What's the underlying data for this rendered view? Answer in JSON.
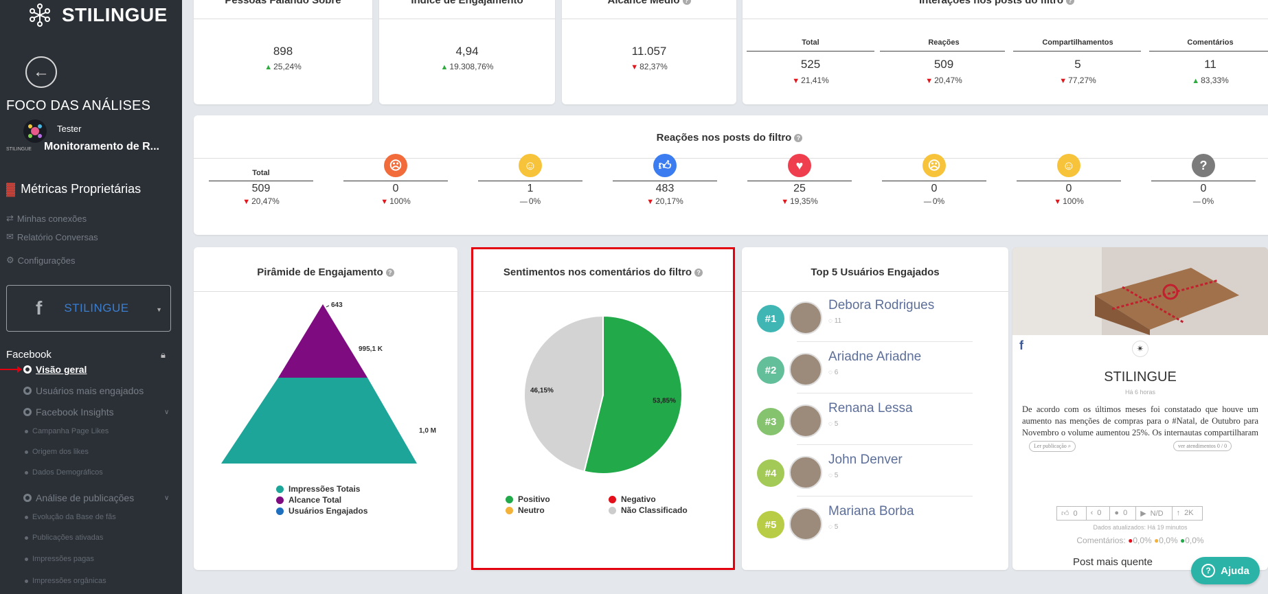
{
  "sidebar": {
    "brand": "STILINGUE",
    "focus_title": "FOCO DAS ANÁLISES",
    "account_user": "Tester",
    "account_small": "STILINGUE",
    "account_project": "Monitoramento de R...",
    "owned_metrics": "Métricas Proprietárias",
    "links": [
      "Minhas conexões",
      "Relatório Conversas",
      "Configurações"
    ],
    "page_selector": "STILINGUE",
    "section": "Facebook",
    "nav": [
      {
        "label": "Visão geral",
        "active": true
      },
      {
        "label": "Usuários mais engajados"
      },
      {
        "label": "Facebook Insights",
        "sub": [
          "Campanha Page Likes",
          "Origem dos likes",
          "Dados Demográficos"
        ]
      },
      {
        "label": "Análise de publicações",
        "sub": [
          "Evolução da Base de fãs",
          "Publicações ativadas",
          "Impressões pagas",
          "Impressões orgânicas"
        ]
      }
    ]
  },
  "top_metrics": [
    {
      "title": "Pessoas Falando Sobre",
      "value": "898",
      "change": "25,24%",
      "trend": "up"
    },
    {
      "title": "Índice de Engajamento",
      "value": "4,94",
      "change": "19.308,76%",
      "trend": "up"
    },
    {
      "title": "Alcance Médio",
      "value": "11.057",
      "change": "82,37%",
      "trend": "down"
    }
  ],
  "interactions": {
    "title": "Interações nos posts do filtro",
    "columns": [
      {
        "label": "Total",
        "value": "525",
        "change": "21,41%",
        "trend": "down"
      },
      {
        "label": "Reações",
        "value": "509",
        "change": "20,47%",
        "trend": "down"
      },
      {
        "label": "Compartilhamentos",
        "value": "5",
        "change": "77,27%",
        "trend": "down"
      },
      {
        "label": "Comentários",
        "value": "11",
        "change": "83,33%",
        "trend": "up"
      }
    ]
  },
  "reactions": {
    "title": "Reações nos posts do filtro",
    "total_label": "Total",
    "columns": [
      {
        "icon": "total",
        "value": "509",
        "change": "20,47%",
        "trend": "down"
      },
      {
        "icon": "angry-icon",
        "color": "#f26b3a",
        "value": "0",
        "change": "100%",
        "trend": "down"
      },
      {
        "icon": "haha-icon",
        "color": "#f7c33b",
        "value": "1",
        "change": "0%",
        "trend": "flat"
      },
      {
        "icon": "like-icon",
        "color": "#3b7cf0",
        "value": "483",
        "change": "20,17%",
        "trend": "down"
      },
      {
        "icon": "love-icon",
        "color": "#ef3f4f",
        "value": "25",
        "change": "19,35%",
        "trend": "down"
      },
      {
        "icon": "sad-icon",
        "color": "#f7c33b",
        "value": "0",
        "change": "0%",
        "trend": "flat"
      },
      {
        "icon": "wow-icon",
        "color": "#f7c33b",
        "value": "0",
        "change": "100%",
        "trend": "down"
      },
      {
        "icon": "question-icon",
        "color": "#7b7b7b",
        "value": "0",
        "change": "0%",
        "trend": "flat"
      }
    ]
  },
  "pyramid": {
    "title": "Pirâmide de Engajamento",
    "labels": [
      "643",
      "995,1 K",
      "1,0 M"
    ],
    "legend": [
      "Impressões Totais",
      "Alcance Total",
      "Usuários Engajados"
    ],
    "colors": {
      "impressoes": "#1ea59a",
      "alcance": "#7e0b80",
      "usuarios": "#1f6fbf"
    }
  },
  "sentiment": {
    "title": "Sentimentos nos comentários do filtro",
    "legend": [
      "Positivo",
      "Negativo",
      "Neutro",
      "Não Classificado"
    ],
    "legend_colors": [
      "#22a94a",
      "#e3101b",
      "#f3b23a",
      "#cccccc"
    ]
  },
  "chart_data": {
    "type": "pie",
    "labels": [
      "Positivo",
      "Não Classificado"
    ],
    "values": [
      53.85,
      46.15
    ],
    "value_labels": [
      "53,85%",
      "46,15%"
    ],
    "colors": [
      "#22a94a",
      "#d3d3d3"
    ]
  },
  "top_users": {
    "title": "Top 5 Usuários Engajados",
    "users": [
      {
        "rank": "#1",
        "name": "Debora Rodrigues",
        "count": "11",
        "color": "#3fb6b4"
      },
      {
        "rank": "#2",
        "name": "Ariadne Ariadne",
        "count": "6",
        "color": "#63bf9a"
      },
      {
        "rank": "#3",
        "name": "Renana Lessa",
        "count": "5",
        "color": "#86c36f"
      },
      {
        "rank": "#4",
        "name": "John Denver",
        "count": "5",
        "color": "#a3c957"
      },
      {
        "rank": "#5",
        "name": "Mariana Borba",
        "count": "5",
        "color": "#b9cc46"
      }
    ]
  },
  "post": {
    "page_name": "STILINGUE",
    "time": "Há 6 horas",
    "text": "De acordo com os últimos meses foi constatado que houve um aumento nas menções de compras para o #Natal, de Outubro para Novembro o volume aumentou 25%. Os internautas compartilharam o",
    "read_button": "Ler publicação",
    "service_button": "ver atendimentos 0 / 0",
    "stats": [
      "0",
      "0",
      "0",
      "N/D",
      "2K"
    ],
    "updated": "Dados atualizados: Há 19 minutos",
    "comments_label": "Comentários:",
    "comment_pcts": [
      "0,0%",
      "0,0%",
      "0,0%"
    ],
    "footer": "Post mais quente"
  },
  "help_button": "Ajuda"
}
